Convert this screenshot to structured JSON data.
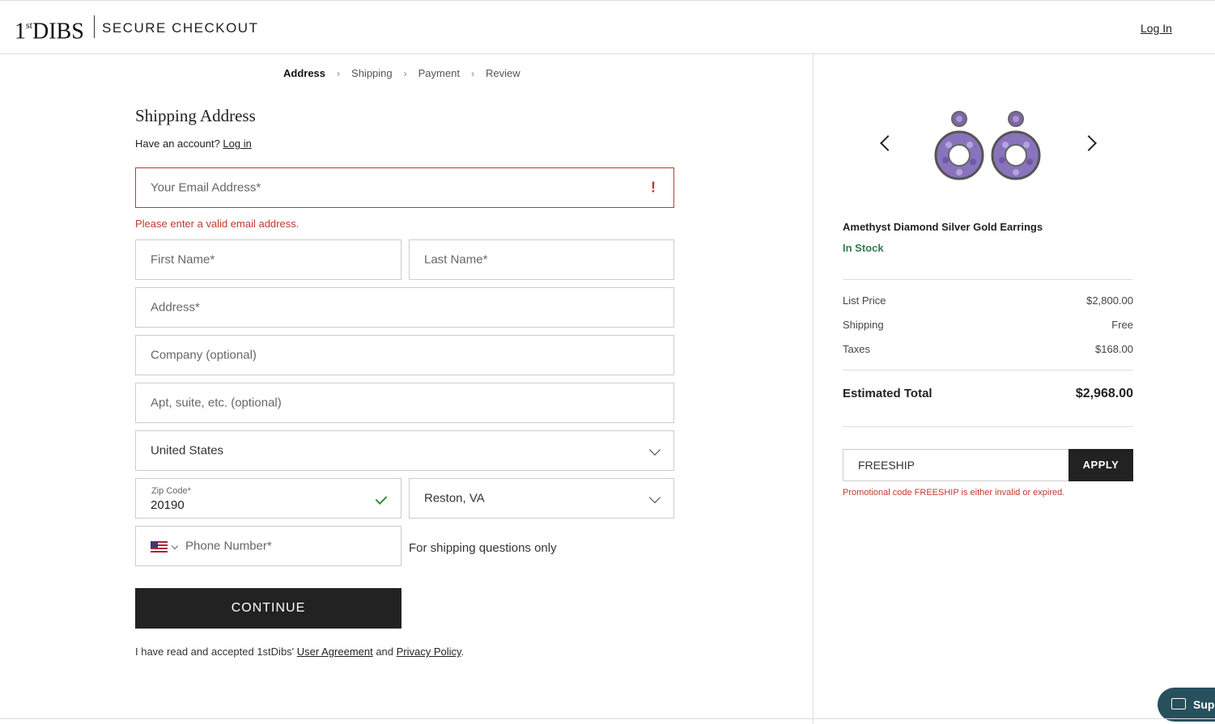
{
  "header": {
    "logo": "1stDIBS",
    "secure_checkout": "SECURE CHECKOUT",
    "login": "Log In"
  },
  "breadcrumb": [
    "Address",
    "Shipping",
    "Payment",
    "Review"
  ],
  "form": {
    "title": "Shipping Address",
    "have_account_prefix": "Have an account? ",
    "have_account_link": "Log in",
    "email_placeholder": "Your Email Address*",
    "email_error": "Please enter a valid email address.",
    "first_name_placeholder": "First Name*",
    "last_name_placeholder": "Last Name*",
    "address_placeholder": "Address*",
    "company_placeholder": "Company (optional)",
    "apt_placeholder": "Apt, suite, etc. (optional)",
    "country_value": "United States",
    "zip_label": "Zip Code*",
    "zip_value": "20190",
    "city_value": "Reston, VA",
    "phone_placeholder": "Phone Number*",
    "shipping_note": "For shipping questions only",
    "continue_label": "CONTINUE",
    "agree_prefix": "I have read and accepted 1stDibs' ",
    "user_agreement": "User Agreement",
    "agree_and": " and ",
    "privacy_policy": "Privacy Policy",
    "agree_suffix": "."
  },
  "summary": {
    "product_name": "Amethyst Diamond Silver Gold Earrings",
    "stock_status": "In Stock",
    "list_price_label": "List Price",
    "list_price_value": "$2,800.00",
    "shipping_label": "Shipping",
    "shipping_value": "Free",
    "taxes_label": "Taxes",
    "taxes_value": "$168.00",
    "total_label": "Estimated Total",
    "total_value": "$2,968.00",
    "promo_value": "FREESHIP",
    "apply_label": "APPLY",
    "promo_error": "Promotional code FREESHIP is either invalid or expired."
  },
  "support": {
    "label": "Sup"
  },
  "colors": {
    "error": "#c0392b",
    "in_stock": "#2f7d4a",
    "primary_button": "#222222",
    "support": "#27505c"
  }
}
